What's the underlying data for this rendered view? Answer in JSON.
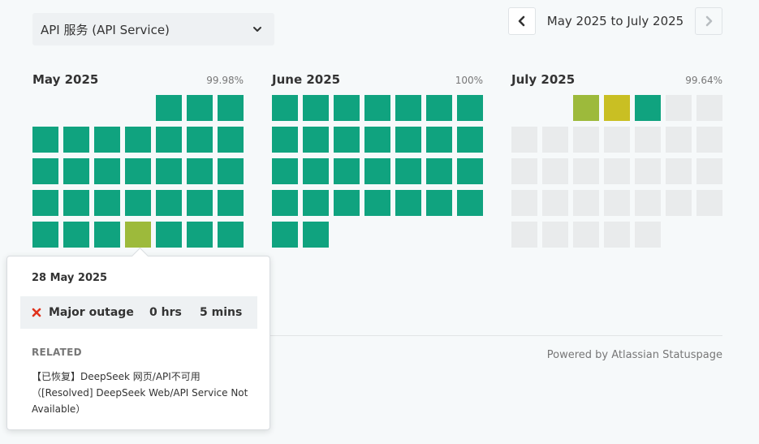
{
  "header": {
    "service_select": "API 服务 (API Service)",
    "date_range": "May 2025 to July 2025"
  },
  "colors": {
    "operational": "#10a37f",
    "minor": "#9dba3b",
    "partial": "#c9bf23",
    "no_data": "#e9ebec"
  },
  "months": [
    {
      "name": "May 2025",
      "uptime": "99.98%",
      "leading_blank_days": 4,
      "days": [
        "up",
        "up",
        "up",
        "up",
        "up",
        "up",
        "up",
        "up",
        "up",
        "up",
        "up",
        "up",
        "up",
        "up",
        "up",
        "up",
        "up",
        "up",
        "up",
        "up",
        "up",
        "up",
        "up",
        "up",
        "up",
        "up",
        "up",
        "minor",
        "up",
        "up",
        "up"
      ]
    },
    {
      "name": "June 2025",
      "uptime": "100%",
      "leading_blank_days": 0,
      "days": [
        "up",
        "up",
        "up",
        "up",
        "up",
        "up",
        "up",
        "up",
        "up",
        "up",
        "up",
        "up",
        "up",
        "up",
        "up",
        "up",
        "up",
        "up",
        "up",
        "up",
        "up",
        "up",
        "up",
        "up",
        "up",
        "up",
        "up",
        "up",
        "up",
        "up"
      ]
    },
    {
      "name": "July 2025",
      "uptime": "99.64%",
      "leading_blank_days": 2,
      "days": [
        "minor",
        "partial",
        "up",
        "future",
        "future",
        "future",
        "future",
        "future",
        "future",
        "future",
        "future",
        "future",
        "future",
        "future",
        "future",
        "future",
        "future",
        "future",
        "future",
        "future",
        "future",
        "future",
        "future",
        "future",
        "future",
        "future",
        "future",
        "future",
        "future",
        "future",
        "future"
      ]
    }
  ],
  "tooltip": {
    "date": "28 May 2025",
    "incident_type": "Major outage",
    "hours": "0 hrs",
    "minutes": "5 mins",
    "related_heading": "RELATED",
    "related_link": "【已恢复】DeepSeek 网页/API不可用（[Resolved] DeepSeek Web/API Service Not Available）"
  },
  "footer": {
    "powered_by": "Powered by Atlassian Statuspage"
  }
}
